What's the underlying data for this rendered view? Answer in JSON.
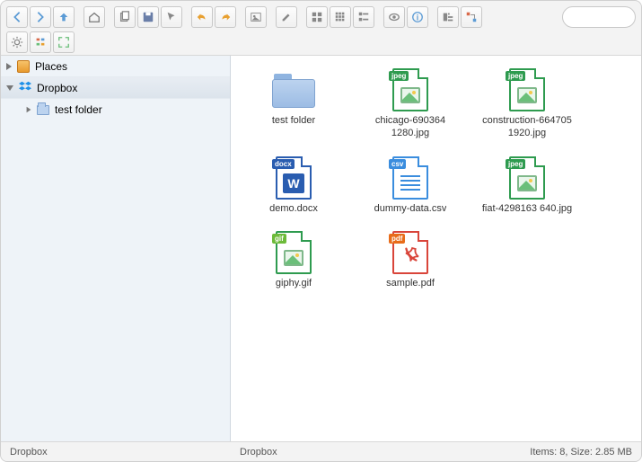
{
  "sidebar": {
    "places_label": "Places",
    "dropbox_label": "Dropbox",
    "tree": [
      {
        "label": "test folder"
      }
    ]
  },
  "files": [
    {
      "name": "test folder",
      "type": "folder"
    },
    {
      "name": "chicago-690364 1280.jpg",
      "type": "jpeg",
      "badge": "jpeg"
    },
    {
      "name": "construction-664705  1920.jpg",
      "type": "jpeg",
      "badge": "jpeg"
    },
    {
      "name": "demo.docx",
      "type": "docx",
      "badge": "docx"
    },
    {
      "name": "dummy-data.csv",
      "type": "csv",
      "badge": "csv"
    },
    {
      "name": "fiat-4298163 640.jpg",
      "type": "jpeg",
      "badge": "jpeg"
    },
    {
      "name": "giphy.gif",
      "type": "gif",
      "badge": "gif"
    },
    {
      "name": "sample.pdf",
      "type": "pdf",
      "badge": "pdf"
    }
  ],
  "status": {
    "left": "Dropbox",
    "mid": "Dropbox",
    "right": "Items: 8, Size: 2.85 MB"
  }
}
